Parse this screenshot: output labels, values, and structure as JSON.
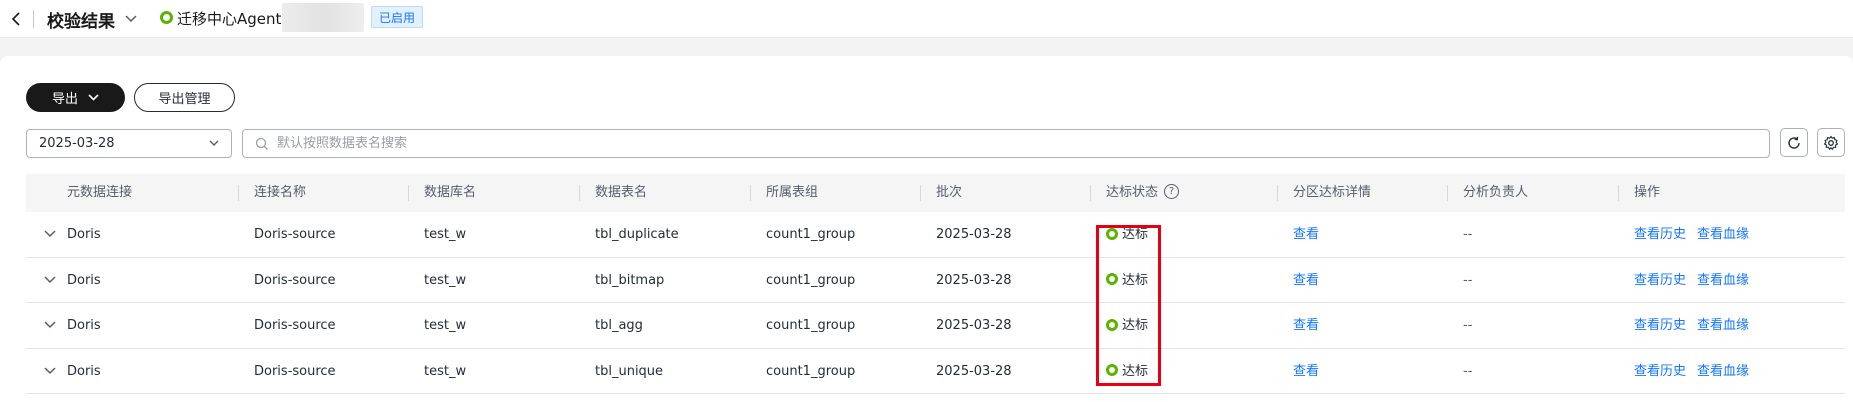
{
  "header": {
    "title": "校验结果",
    "agent_label": "迁移中心Agent:",
    "agent_badge": "已启用"
  },
  "toolbar": {
    "export_label": "导出",
    "export_mgmt_label": "导出管理"
  },
  "filters": {
    "date_value": "2025-03-28",
    "search_placeholder": "默认按照数据表名搜索"
  },
  "table": {
    "columns": [
      "元数据连接",
      "连接名称",
      "数据库名",
      "数据表名",
      "所属表组",
      "批次",
      "达标状态",
      "分区达标详情",
      "分析负责人",
      "操作"
    ],
    "rows": [
      {
        "meta_conn": "Doris",
        "conn_name": "Doris-source",
        "db_name": "test_w",
        "table_name": "tbl_duplicate",
        "group": "count1_group",
        "batch": "2025-03-28",
        "status": "达标",
        "partition_detail": "查看",
        "owner": "--",
        "action_history": "查看历史",
        "action_lineage": "查看血缘"
      },
      {
        "meta_conn": "Doris",
        "conn_name": "Doris-source",
        "db_name": "test_w",
        "table_name": "tbl_bitmap",
        "group": "count1_group",
        "batch": "2025-03-28",
        "status": "达标",
        "partition_detail": "查看",
        "owner": "--",
        "action_history": "查看历史",
        "action_lineage": "查看血缘"
      },
      {
        "meta_conn": "Doris",
        "conn_name": "Doris-source",
        "db_name": "test_w",
        "table_name": "tbl_agg",
        "group": "count1_group",
        "batch": "2025-03-28",
        "status": "达标",
        "partition_detail": "查看",
        "owner": "--",
        "action_history": "查看历史",
        "action_lineage": "查看血缘"
      },
      {
        "meta_conn": "Doris",
        "conn_name": "Doris-source",
        "db_name": "test_w",
        "table_name": "tbl_unique",
        "group": "count1_group",
        "batch": "2025-03-28",
        "status": "达标",
        "partition_detail": "查看",
        "owner": "--",
        "action_history": "查看历史",
        "action_lineage": "查看血缘"
      }
    ]
  },
  "colors": {
    "status_green": "#5cb300",
    "link_blue": "#1476ff",
    "highlight_red": "#e60012"
  }
}
